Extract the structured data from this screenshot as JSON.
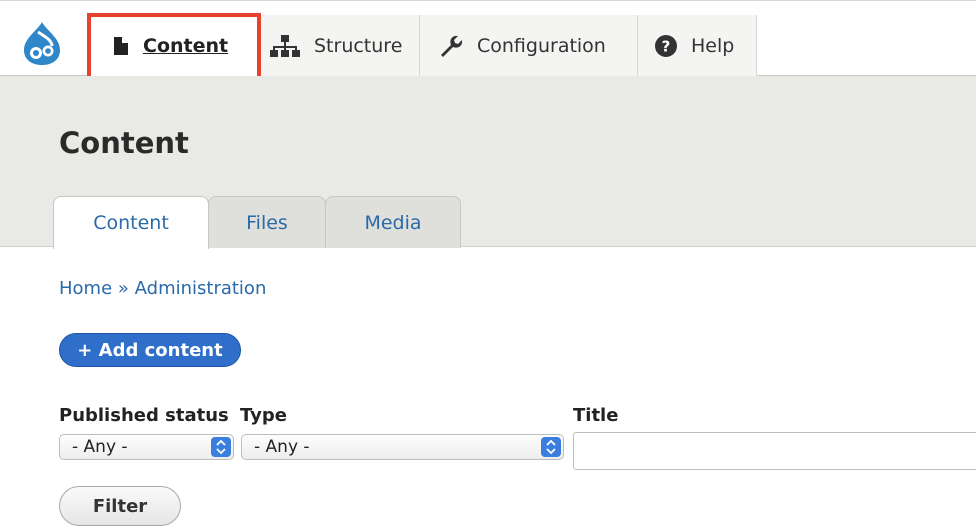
{
  "toolbar": {
    "logo_icon": "drupal-drop-icon",
    "items": [
      {
        "label": "Content",
        "icon": "file-icon",
        "active": true
      },
      {
        "label": "Structure",
        "icon": "sitemap-icon",
        "active": false
      },
      {
        "label": "Configuration",
        "icon": "wrench-icon",
        "active": false
      },
      {
        "label": "Help",
        "icon": "question-circle-icon",
        "active": false
      }
    ],
    "highlight_color": "#e8422e"
  },
  "page": {
    "title": "Content",
    "tabs": [
      {
        "label": "Content",
        "active": true
      },
      {
        "label": "Files",
        "active": false
      },
      {
        "label": "Media",
        "active": false
      }
    ]
  },
  "breadcrumb": {
    "home": "Home",
    "separator": "»",
    "current": "Administration"
  },
  "actions": {
    "add_content": "+ Add content"
  },
  "filters": {
    "published_status": {
      "label": "Published status",
      "value": "- Any -"
    },
    "type": {
      "label": "Type",
      "value": "- Any -"
    },
    "title": {
      "label": "Title",
      "value": ""
    },
    "submit": "Filter"
  },
  "colors": {
    "link": "#2a6aa8",
    "primary_button": "#2f6ec9",
    "header_bg": "#e9e9e5"
  }
}
